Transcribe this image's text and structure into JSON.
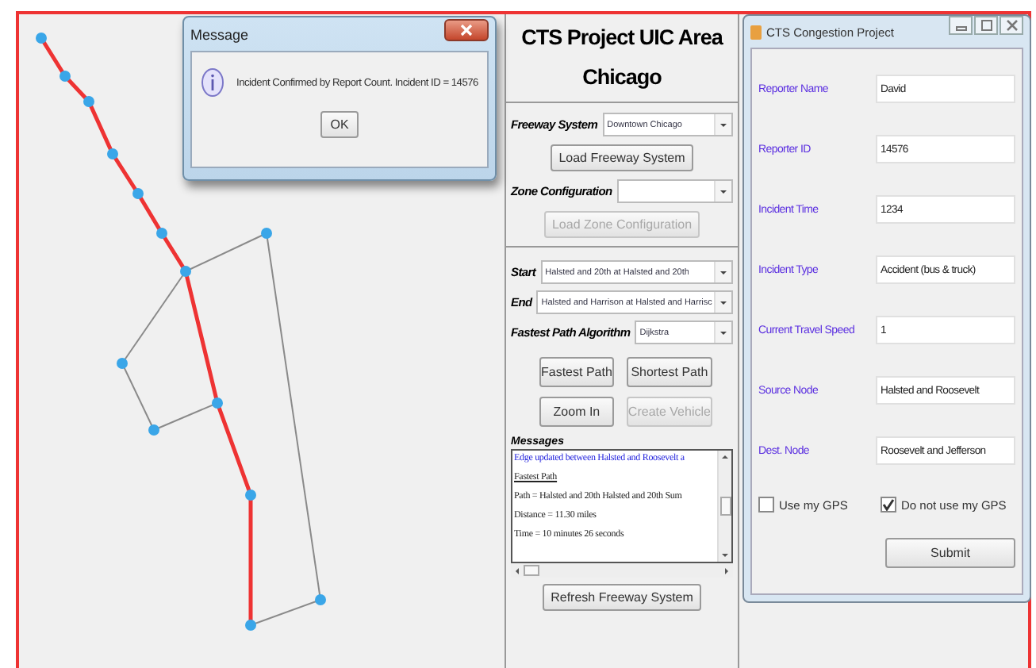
{
  "dialog": {
    "title": "Message",
    "message": "Incident Confirmed by Report Count. Incident ID = 14576",
    "button": "OK"
  },
  "control_panel": {
    "title": "CTS Project UIC Area Chicago",
    "freeway_system": {
      "label": "Freeway System",
      "value": "Downtown Chicago",
      "button": {
        "label": "Load Freeway System",
        "disabled": false
      }
    },
    "zone_configuration": {
      "label": "Zone Configuration",
      "button": {
        "label": "Load Zone Configuration",
        "disabled": true
      }
    },
    "start": {
      "label": "Start",
      "value": "Halsted and 20th at Halsted and 20th"
    },
    "end": {
      "label": "End",
      "value": "Halsted and Harrison at Halsted and Harrisc"
    },
    "algorithm": {
      "label": "Fastest Path Algorithm",
      "value": "Dijkstra"
    },
    "buttons": [
      {
        "label": "Fastest Path",
        "disabled": false
      },
      {
        "label": "Shortest Path",
        "disabled": false
      },
      {
        "label": "Zoom In",
        "disabled": false
      },
      {
        "label": "Create Vehicle",
        "disabled": true
      }
    ],
    "messages": {
      "label": "Messages",
      "lines": [
        {
          "kind": "notice",
          "text": "Edge updated between Halsted and Roosevelt a"
        },
        {
          "kind": "heading",
          "text": "Fastest Path"
        },
        {
          "kind": "plain",
          "text": "Path = Halsted and 20th Halsted and 20th Sum"
        },
        {
          "kind": "plain",
          "text": "Distance = 11.30 miles"
        },
        {
          "kind": "plain",
          "text": "Time = 10 minutes 26 seconds"
        }
      ]
    },
    "refresh_button": "Refresh Freeway System"
  },
  "report_window": {
    "title": "CTS Congestion Project",
    "fields": [
      {
        "label": "Reporter Name",
        "value": "David"
      },
      {
        "label": "Reporter ID",
        "value": "14576"
      },
      {
        "label": "Incident Time",
        "value": "1234"
      },
      {
        "label": "Incident Type",
        "value": "Accident (bus & truck)"
      },
      {
        "label": "Current Travel Speed",
        "value": "1"
      },
      {
        "label": "Source Node",
        "value": "Halsted and Roosevelt"
      },
      {
        "label": "Dest. Node",
        "value": "Roosevelt and Jefferson"
      }
    ],
    "checkboxes": [
      {
        "label": "Use my GPS",
        "checked": false
      },
      {
        "label": "Do not use my GPS",
        "checked": true
      }
    ],
    "submit": "Submit"
  }
}
